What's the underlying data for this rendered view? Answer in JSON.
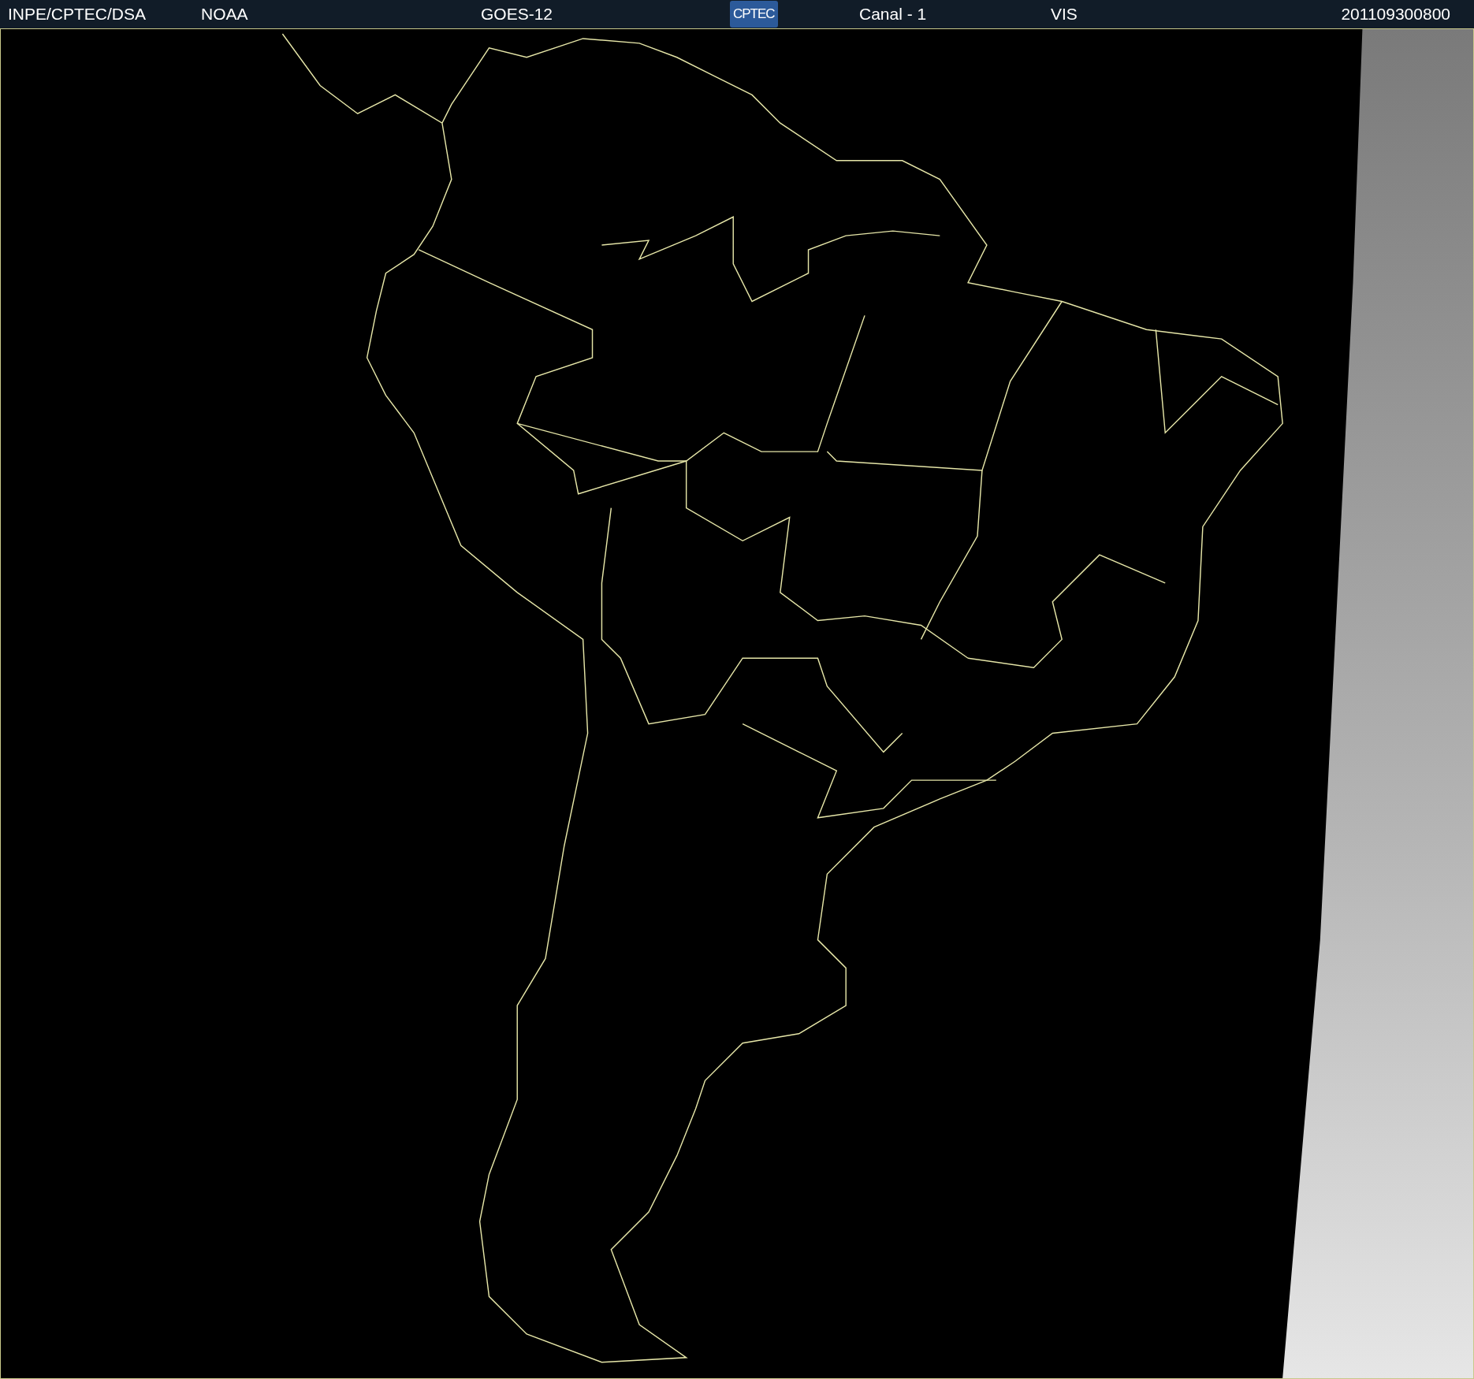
{
  "header": {
    "items": [
      {
        "kind": "text",
        "text": "INPE/CPTEC/DSA"
      },
      {
        "kind": "text",
        "text": "NOAA"
      },
      {
        "kind": "text",
        "text": "GOES-12"
      },
      {
        "kind": "logo",
        "text": "CPTEC"
      },
      {
        "kind": "text",
        "text": "Canal - 1"
      },
      {
        "kind": "text",
        "text": "VIS"
      },
      {
        "kind": "text",
        "text": "201109300800"
      }
    ]
  }
}
